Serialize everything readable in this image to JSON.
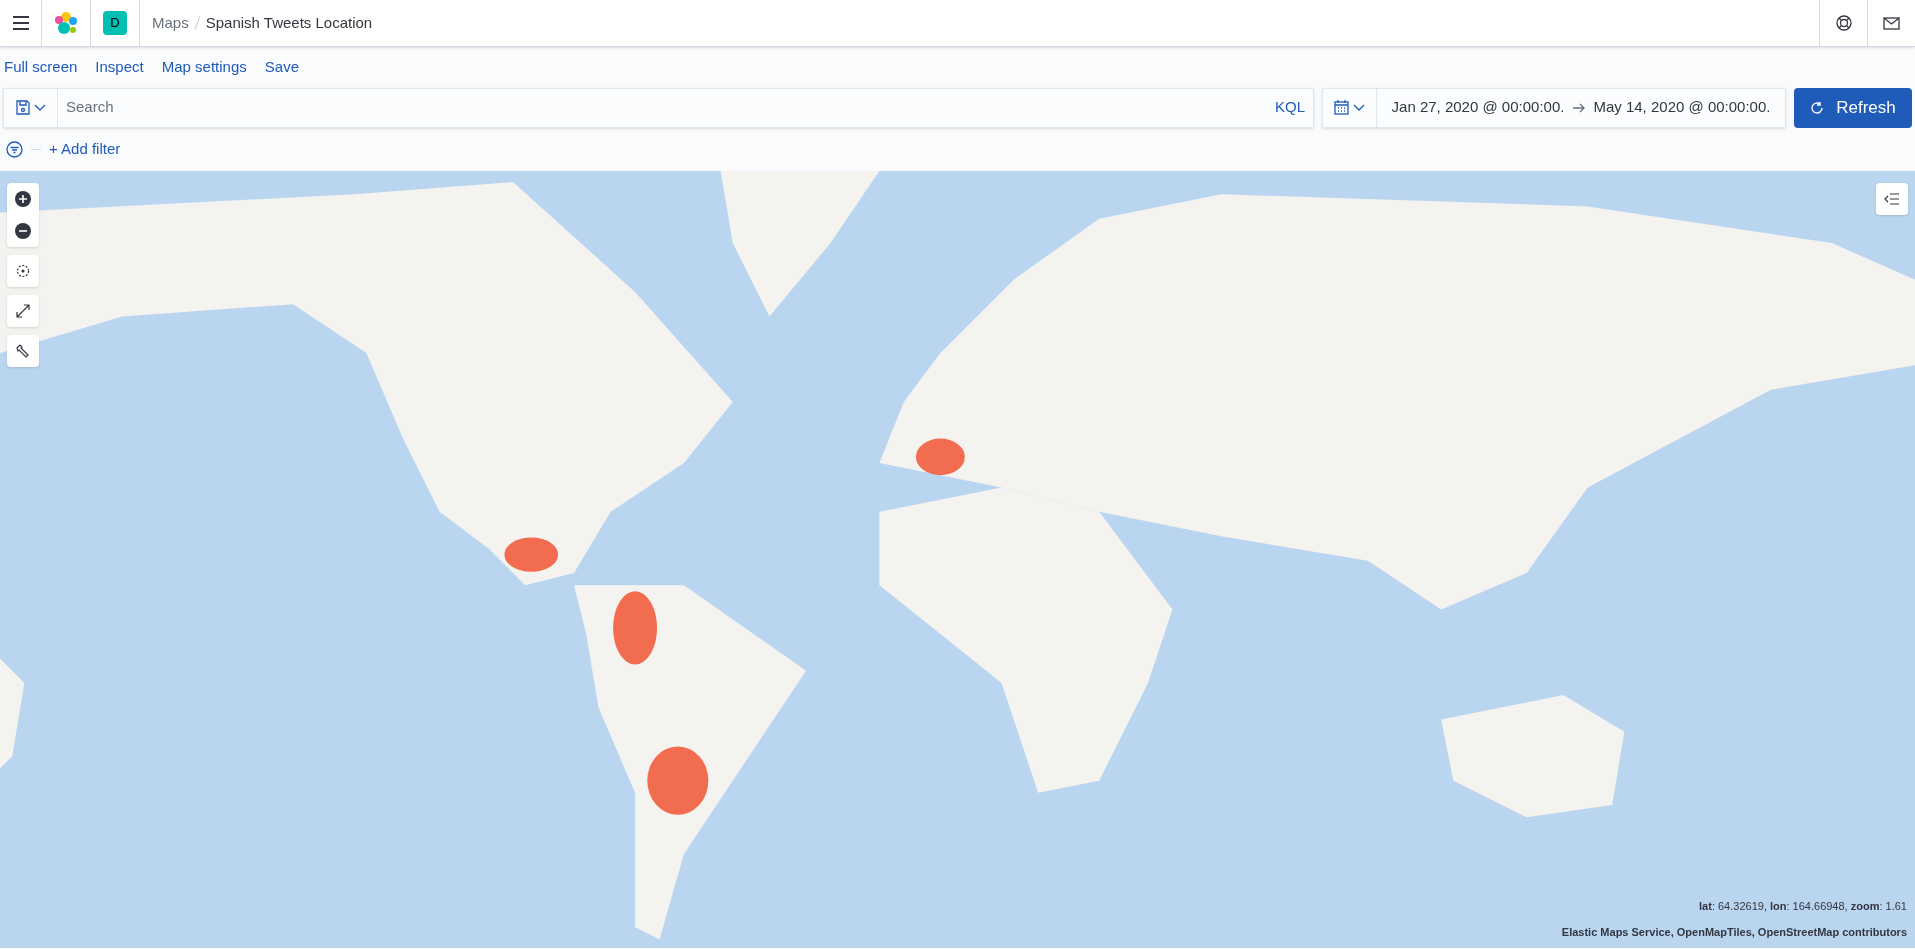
{
  "header": {
    "breadcrumbs": [
      {
        "label": "Maps",
        "current": false
      },
      {
        "label": "Spanish Tweets Location",
        "current": true
      }
    ],
    "space_avatar": "D"
  },
  "actions": [
    "Full screen",
    "Inspect",
    "Map settings",
    "Save"
  ],
  "query_bar": {
    "placeholder": "Search",
    "language": "KQL",
    "start": "Jan 27, 2020 @ 00:00:00.",
    "end": "May 14, 2020 @ 00:00:00.",
    "refresh": "Refresh"
  },
  "filter_bar": {
    "add_filter": "+ Add filter"
  },
  "map": {
    "coordinates": "**lat**: 64.32619, **lon**: 164.66948, **zoom**: 1.61",
    "attribution": "Elastic Maps Service, OpenMapTiles, OpenStreetMap contributors"
  }
}
